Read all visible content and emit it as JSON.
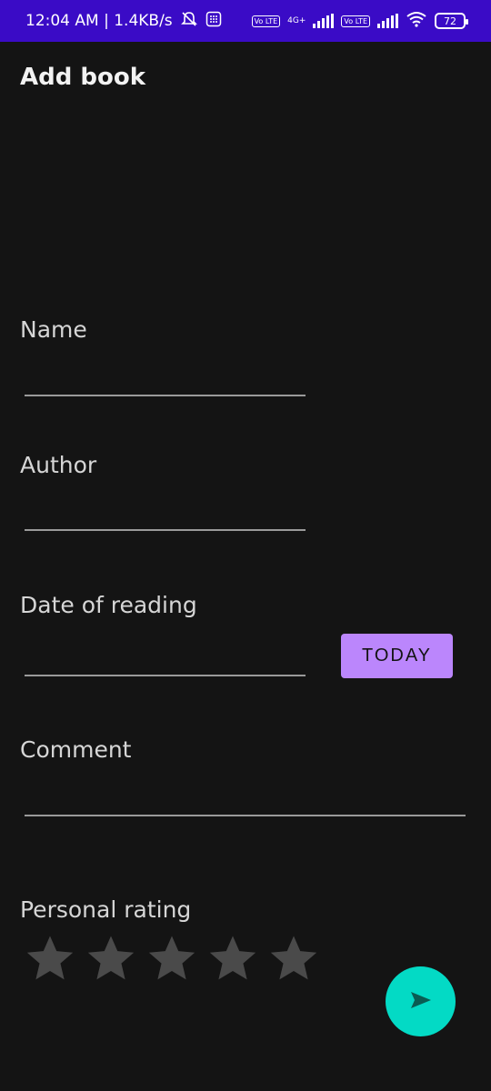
{
  "status_bar": {
    "time_speed": "12:04 AM | 1.4KB/s",
    "volte1": "Vo LTE",
    "network_type": "4G+",
    "volte2": "Vo LTE",
    "battery": "72"
  },
  "page": {
    "title": "Add book"
  },
  "form": {
    "name_label": "Name",
    "author_label": "Author",
    "date_label": "Date of reading",
    "today_button": "TODAY",
    "comment_label": "Comment",
    "rating_label": "Personal rating",
    "rating_value": 0,
    "rating_max": 5
  },
  "colors": {
    "status_bar": "#3a0bc6",
    "background": "#141414",
    "accent_purple": "#bb86fc",
    "fab_teal": "#03dac5",
    "star_inactive": "#4a4a4a"
  },
  "icons": {
    "fab": "send-icon",
    "rating": "star-icon"
  }
}
